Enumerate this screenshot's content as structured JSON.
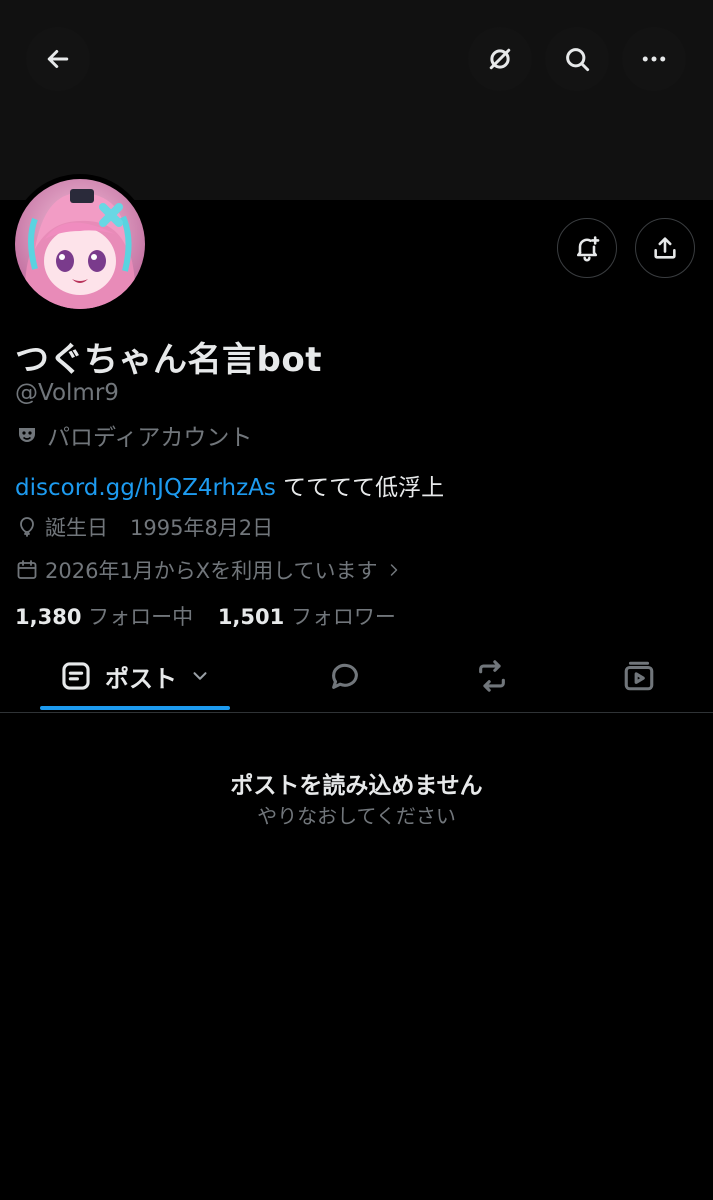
{
  "profile": {
    "display_name": "つぐちゃん名言bot",
    "handle": "@Volmr9",
    "parody_label": "パロディアカウント",
    "bio_link": "discord.gg/hJQZ4rhzAs",
    "bio_text": " てててて低浮上",
    "birthday_label": "誕生日",
    "birthday_value": "1995年8月2日",
    "joined": "2026年1月からXを利用しています",
    "following_count": "1,380",
    "following_label": "フォロー中",
    "followers_count": "1,501",
    "followers_label": "フォロワー"
  },
  "header": {
    "icons": [
      "back-arrow-icon",
      "grok-icon",
      "search-icon",
      "more-icon"
    ]
  },
  "tabs": {
    "posts_label": "ポスト",
    "icons": [
      "posts-icon",
      "replies-icon",
      "reposts-icon",
      "media-icon"
    ]
  },
  "empty_state": {
    "title": "ポストを読み込めません",
    "subtitle": "やりなおしてください"
  },
  "colors": {
    "background": "#000000",
    "banner": "#111111",
    "accent": "#1d9bf0",
    "text_primary": "#e7e9ea",
    "text_secondary": "#71767b"
  }
}
